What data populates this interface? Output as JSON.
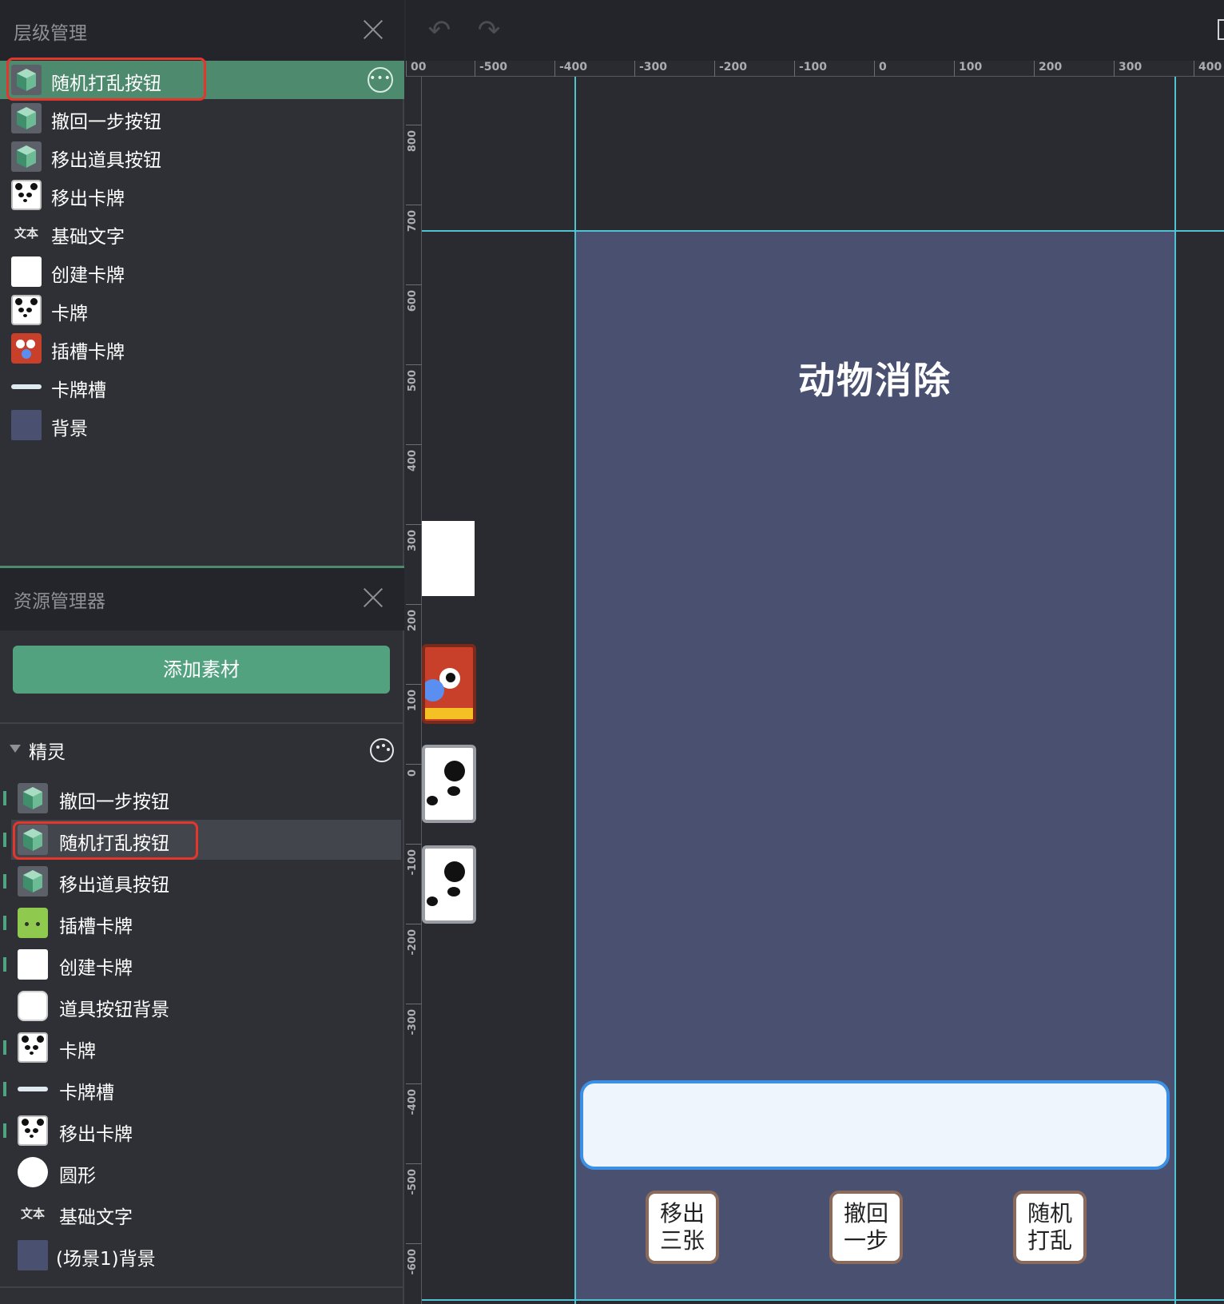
{
  "hierarchy_panel": {
    "title": "层级管理",
    "items": [
      {
        "label": "随机打乱按钮",
        "icon": "cube-icon",
        "selected": true
      },
      {
        "label": "撤回一步按钮",
        "icon": "cube-icon"
      },
      {
        "label": "移出道具按钮",
        "icon": "cube-icon"
      },
      {
        "label": "移出卡牌",
        "icon": "panda-icon"
      },
      {
        "label": "基础文字",
        "icon": "text-icon",
        "icon_text": "文本"
      },
      {
        "label": "创建卡牌",
        "icon": "white-square-icon"
      },
      {
        "label": "卡牌",
        "icon": "panda-icon"
      },
      {
        "label": "插槽卡牌",
        "icon": "parrot-icon"
      },
      {
        "label": "卡牌槽",
        "icon": "bar-icon"
      },
      {
        "label": "背景",
        "icon": "background-swatch-icon"
      }
    ]
  },
  "asset_panel": {
    "title": "资源管理器",
    "add_button": "添加素材",
    "section_label": "精灵",
    "items": [
      {
        "label": "撤回一步按钮",
        "icon": "cube-icon"
      },
      {
        "label": "随机打乱按钮",
        "icon": "cube-icon",
        "selected": true
      },
      {
        "label": "移出道具按钮",
        "icon": "cube-icon"
      },
      {
        "label": "插槽卡牌",
        "icon": "green-block-icon"
      },
      {
        "label": "创建卡牌",
        "icon": "white-square-icon"
      },
      {
        "label": "道具按钮背景",
        "icon": "rounded-square-icon"
      },
      {
        "label": "卡牌",
        "icon": "panda-icon"
      },
      {
        "label": "卡牌槽",
        "icon": "bar-icon"
      },
      {
        "label": "移出卡牌",
        "icon": "panda-icon"
      },
      {
        "label": "圆形",
        "icon": "circle-icon"
      },
      {
        "label": "基础文字",
        "icon": "text-icon",
        "icon_text": "文本"
      },
      {
        "label": "(场景1)背景",
        "icon": "background-swatch-icon"
      }
    ]
  },
  "canvas": {
    "ruler_top": [
      "00",
      "-500",
      "-400",
      "-300",
      "-200",
      "-100",
      "0",
      "100",
      "200",
      "300",
      "400"
    ],
    "ruler_left": [
      "800",
      "700",
      "600",
      "500",
      "400",
      "300",
      "200",
      "100",
      "0",
      "-100",
      "-200",
      "-300",
      "-400",
      "-500",
      "-600"
    ],
    "stage_title": "动物消除",
    "buttons": [
      {
        "line1": "移出",
        "line2": "三张"
      },
      {
        "line1": "撤回",
        "line2": "一步"
      },
      {
        "line1": "随机",
        "line2": "打乱"
      }
    ]
  },
  "colors": {
    "accent": "#52a17f",
    "highlight": "#e5362b",
    "stage_background": "#4a5070",
    "guide": "#4fc3d2"
  }
}
